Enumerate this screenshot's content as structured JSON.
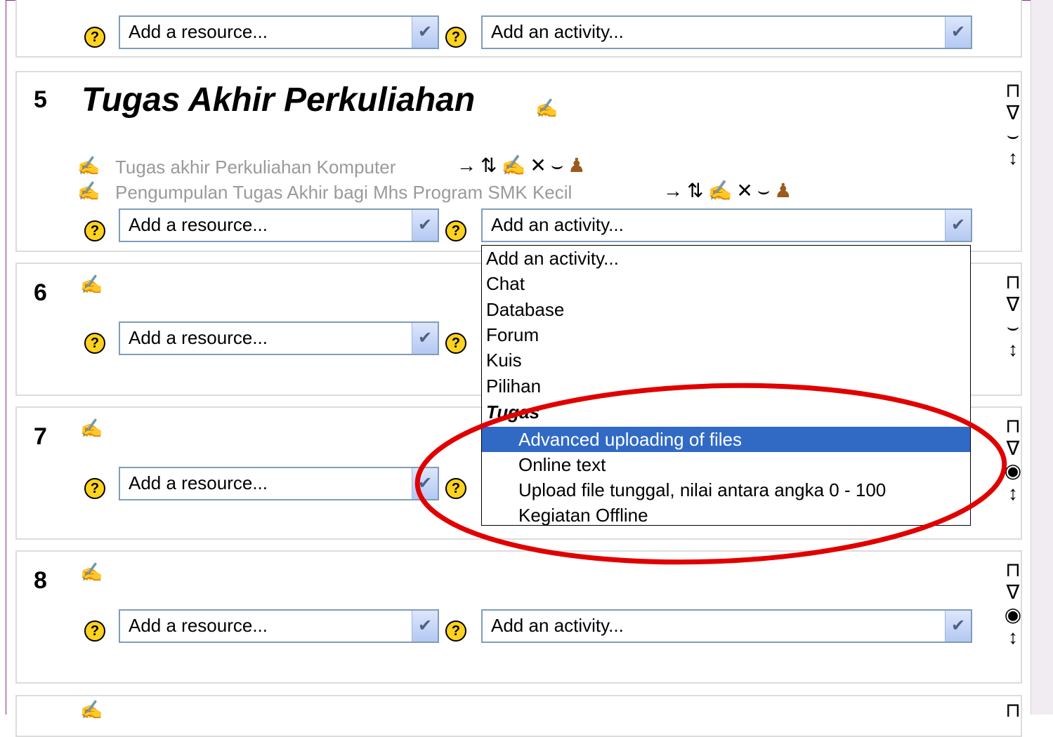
{
  "top_section": {
    "resource_placeholder": "Add a resource...",
    "activity_placeholder": "Add an activity..."
  },
  "sections": [
    {
      "number": "5",
      "title": "Tugas Akhir Perkuliahan",
      "resources": [
        "Tugas akhir Perkuliahan Komputer",
        "Pengumpulan Tugas Akhir bagi Mhs Program SMK Kecil"
      ],
      "resource_select": "Add a resource...",
      "activity_select": "Add an activity..."
    },
    {
      "number": "6",
      "resource_select": "Add a resource..."
    },
    {
      "number": "7",
      "resource_select": "Add a resource..."
    },
    {
      "number": "8",
      "resource_select": "Add a resource...",
      "activity_select": "Add an activity..."
    }
  ],
  "activity_dropdown": {
    "options": [
      {
        "label": "Add an activity..."
      },
      {
        "label": "Chat"
      },
      {
        "label": "Database"
      },
      {
        "label": "Forum"
      },
      {
        "label": "Kuis"
      },
      {
        "label": "Pilihan"
      }
    ],
    "group_label": "Tugas",
    "group_options": [
      {
        "label": "Advanced uploading of files",
        "selected": true
      },
      {
        "label": "Online text"
      },
      {
        "label": "Upload file tunggal, nilai antara angka 0 - 100"
      },
      {
        "label": "Kegiatan Offline"
      }
    ]
  },
  "icons": {
    "help": "help-icon",
    "edit": "edit-icon",
    "move-right": "arrow-right-icon",
    "move": "move-icon",
    "delete": "delete-icon",
    "hide": "eye-icon",
    "assign-roles": "roles-icon",
    "resource": "resource-icon"
  },
  "colors": {
    "highlight": "#316ac5",
    "annotation": "#e00000",
    "help_icon": "#ffd21f"
  }
}
